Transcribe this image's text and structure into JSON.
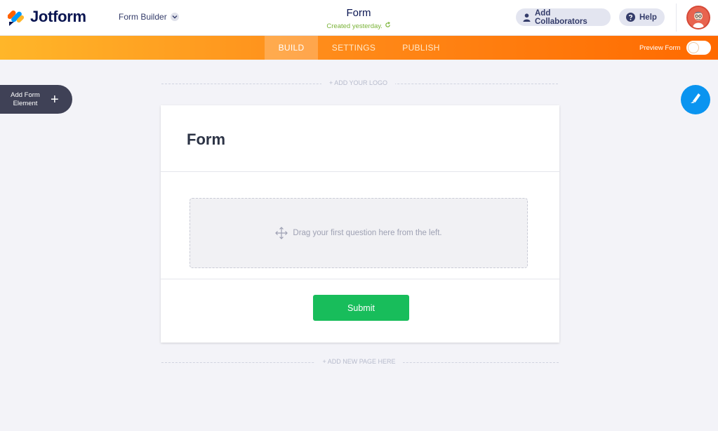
{
  "header": {
    "brand": "Jotform",
    "builder_label": "Form Builder",
    "form_title": "Form",
    "created_status": "Created yesterday.",
    "collaborators_label": "Add Collaborators",
    "help_label": "Help"
  },
  "nav": {
    "tabs": [
      {
        "label": "BUILD",
        "active": true
      },
      {
        "label": "SETTINGS",
        "active": false
      },
      {
        "label": "PUBLISH",
        "active": false
      }
    ],
    "preview_label": "Preview Form",
    "preview_enabled": false
  },
  "canvas": {
    "add_logo": "+ ADD YOUR LOGO",
    "add_element_label": "Add Form Element",
    "add_element_plus": "+",
    "form_heading": "Form",
    "dropzone_text": "Drag your first question here from the left.",
    "submit_label": "Submit",
    "add_page": "+ ADD NEW PAGE HERE"
  },
  "colors": {
    "brand_navy": "#0a1551",
    "nav_orange_start": "#ffb629",
    "nav_orange_end": "#ff6a00",
    "submit_green": "#18bd5b",
    "designer_blue": "#0a94f0",
    "created_green": "#7ab338"
  },
  "icons": [
    "jotform-logo-icon",
    "chevron-down-icon",
    "refresh-icon",
    "user-icon",
    "help-icon",
    "avatar",
    "plus-icon",
    "paint-brush-icon",
    "move-icon"
  ]
}
